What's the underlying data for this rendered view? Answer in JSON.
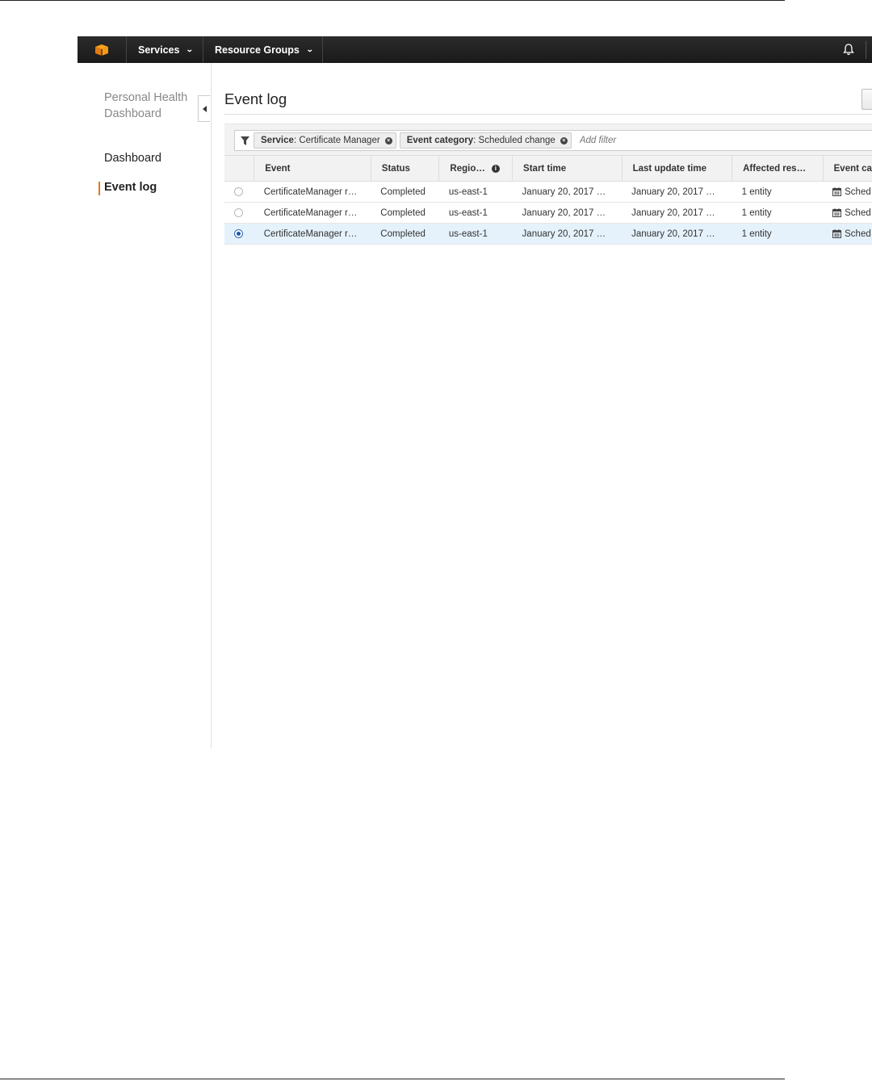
{
  "nav": {
    "services_label": "Services",
    "resource_groups_label": "Resource Groups"
  },
  "sidebar": {
    "title": "Personal Health Dashboard",
    "items": [
      {
        "label": "Dashboard",
        "active": false
      },
      {
        "label": "Event log",
        "active": true
      }
    ]
  },
  "main": {
    "title": "Event log",
    "filters": [
      {
        "key": "Service",
        "value": "Certificate Manager"
      },
      {
        "key": "Event category",
        "value": "Scheduled change"
      }
    ],
    "filter_placeholder": "Add filter",
    "columns": [
      "Event",
      "Status",
      "Regio…",
      "Start time",
      "Last update time",
      "Affected res…",
      "Event ca"
    ],
    "rows": [
      {
        "event": "CertificateManager r…",
        "status": "Completed",
        "region": "us-east-1",
        "start": "January 20, 2017 …",
        "updated": "January 20, 2017 …",
        "affected": "1 entity",
        "category": "Sched",
        "selected": false
      },
      {
        "event": "CertificateManager r…",
        "status": "Completed",
        "region": "us-east-1",
        "start": "January 20, 2017 …",
        "updated": "January 20, 2017 …",
        "affected": "1 entity",
        "category": "Sched",
        "selected": false
      },
      {
        "event": "CertificateManager r…",
        "status": "Completed",
        "region": "us-east-1",
        "start": "January 20, 2017 …",
        "updated": "January 20, 2017 …",
        "affected": "1 entity",
        "category": "Sched",
        "selected": true
      }
    ]
  },
  "colors": {
    "nav_bg": "#232323",
    "accent": "#e47911",
    "status_ok": "#1d8102",
    "link": "#1a6ec2",
    "selected_row": "#e5f2fc"
  }
}
